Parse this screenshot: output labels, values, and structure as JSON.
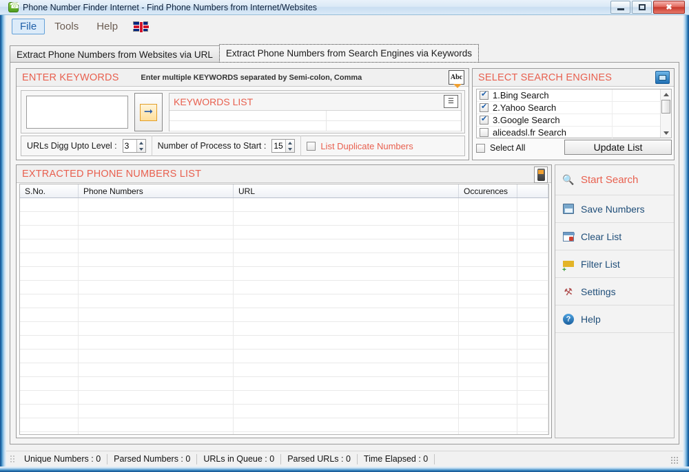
{
  "window": {
    "title": "Phone Number Finder Internet - Find Phone Numbers from Internet/Websites",
    "app_icon": "phone-icon",
    "buttons": {
      "minimize": "minimize-icon",
      "maximize": "maximize-icon",
      "close": "✖"
    }
  },
  "menu": {
    "items": [
      {
        "label": "File",
        "active": true
      },
      {
        "label": "Tools",
        "active": false
      },
      {
        "label": "Help",
        "active": false
      }
    ],
    "flag": "uk-flag-icon"
  },
  "tabs": [
    {
      "label": "Extract Phone Numbers from Websites via URL",
      "selected": false
    },
    {
      "label": "Extract Phone Numbers from Search Engines via Keywords",
      "selected": true
    }
  ],
  "keywords_panel": {
    "title": "ENTER KEYWORDS",
    "hint": "Enter multiple KEYWORDS separated by Semi-colon, Comma",
    "abc_icon_label": "Abc",
    "input_value": "",
    "input_placeholder": "",
    "add_button_icon": "arrow-right-icon",
    "list_title": "KEYWORDS LIST",
    "list_icon": "list-options-icon",
    "list_rows": [
      {
        "c1": "",
        "c2": ""
      },
      {
        "c1": "",
        "c2": ""
      }
    ]
  },
  "options": {
    "urls_digg_label": "URLs Digg Upto Level :",
    "urls_digg_value": "3",
    "process_label": "Number of Process to Start :",
    "process_value": "15",
    "duplicate_label": "List Duplicate Numbers",
    "duplicate_checked": false
  },
  "search_engines": {
    "title": "SELECT SEARCH ENGINES",
    "header_icon": "window-expand-icon",
    "items": [
      {
        "label": "1.Bing Search",
        "checked": true
      },
      {
        "label": "2.Yahoo Search",
        "checked": true
      },
      {
        "label": "3.Google Search",
        "checked": true
      },
      {
        "label": "aliceadsl.fr Search",
        "checked": false
      }
    ],
    "select_all_label": "Select All",
    "select_all_checked": false,
    "update_button": "Update List"
  },
  "extracted": {
    "title": "EXTRACTED PHONE NUMBERS LIST",
    "header_icon": "mobile-phone-icon",
    "columns": [
      "S.No.",
      "Phone Numbers",
      "URL",
      "Occurences",
      ""
    ],
    "rows": []
  },
  "actions": [
    {
      "label": "Start Search",
      "icon": "search-icon",
      "primary": true
    },
    {
      "label": "Save Numbers",
      "icon": "save-icon",
      "primary": false
    },
    {
      "label": "Clear List",
      "icon": "clear-list-icon",
      "primary": false
    },
    {
      "label": "Filter List",
      "icon": "filter-icon",
      "primary": false
    },
    {
      "label": "Settings",
      "icon": "tools-icon",
      "primary": false
    },
    {
      "label": "Help",
      "icon": "help-icon",
      "primary": false
    }
  ],
  "status": [
    "Unique Numbers :  0",
    "Parsed Numbers :  0",
    "URLs in Queue :  0",
    "Parsed URLs :  0",
    "Time Elapsed : 0"
  ],
  "colors": {
    "accent_red": "#e8604f",
    "link_blue": "#1f4e79",
    "title_blue": "#0b1f3a",
    "frame_blue": "#134d8c"
  }
}
